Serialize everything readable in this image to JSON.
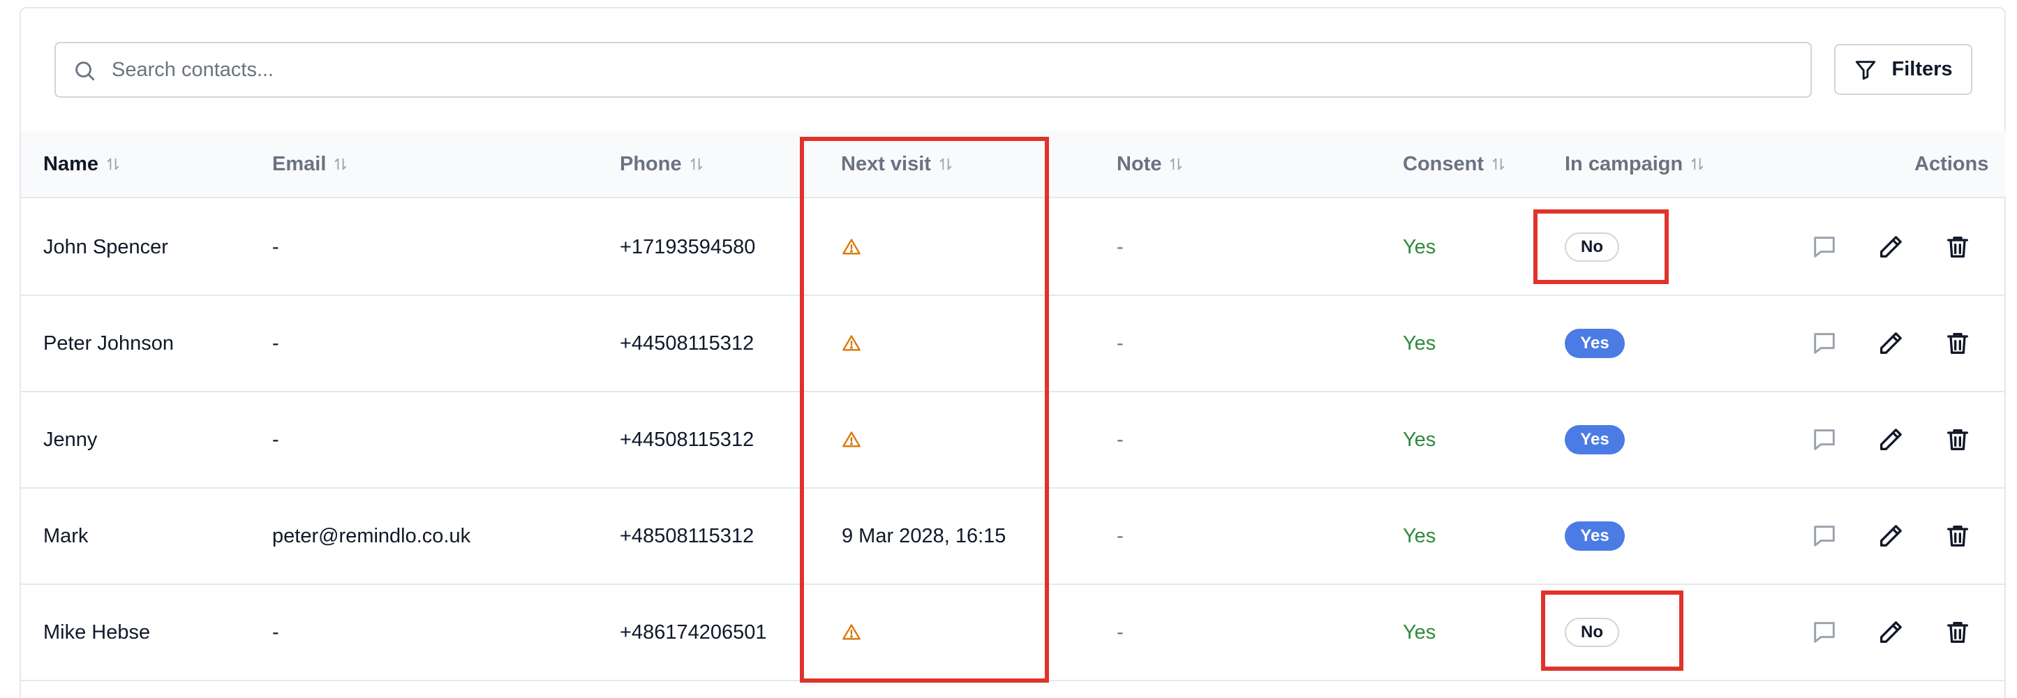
{
  "search": {
    "placeholder": "Search contacts..."
  },
  "toolbar": {
    "filters_label": "Filters"
  },
  "columns": {
    "name": "Name",
    "email": "Email",
    "phone": "Phone",
    "next_visit": "Next visit",
    "note": "Note",
    "consent": "Consent",
    "in_campaign": "In campaign",
    "actions": "Actions"
  },
  "rows": [
    {
      "name": "John Spencer",
      "email": "-",
      "phone": "+17193594580",
      "next_visit": "",
      "next_visit_warning": true,
      "note": "-",
      "consent": "Yes",
      "in_campaign": "No"
    },
    {
      "name": "Peter Johnson",
      "email": "-",
      "phone": "+44508115312",
      "next_visit": "",
      "next_visit_warning": true,
      "note": "-",
      "consent": "Yes",
      "in_campaign": "Yes"
    },
    {
      "name": "Jenny",
      "email": "-",
      "phone": "+44508115312",
      "next_visit": "",
      "next_visit_warning": true,
      "note": "-",
      "consent": "Yes",
      "in_campaign": "Yes"
    },
    {
      "name": "Mark",
      "email": "peter@remindlo.co.uk",
      "phone": "+48508115312",
      "next_visit": "9 Mar 2028, 16:15",
      "next_visit_warning": false,
      "note": "-",
      "consent": "Yes",
      "in_campaign": "Yes"
    },
    {
      "name": "Mike Hebse",
      "email": "-",
      "phone": "+486174206501",
      "next_visit": "",
      "next_visit_warning": true,
      "note": "-",
      "consent": "Yes",
      "in_campaign": "No"
    }
  ],
  "icons": {
    "search": "search-icon",
    "filter": "filter-icon",
    "sort": "sort-icon",
    "warning": "warning-icon",
    "message": "message-icon",
    "edit": "pencil-icon",
    "delete": "trash-icon"
  },
  "colors": {
    "consent_yes": "#2e8b3a",
    "campaign_yes_bg": "#4b7be5",
    "warning": "#d97706",
    "annotation": "#e0332b"
  }
}
